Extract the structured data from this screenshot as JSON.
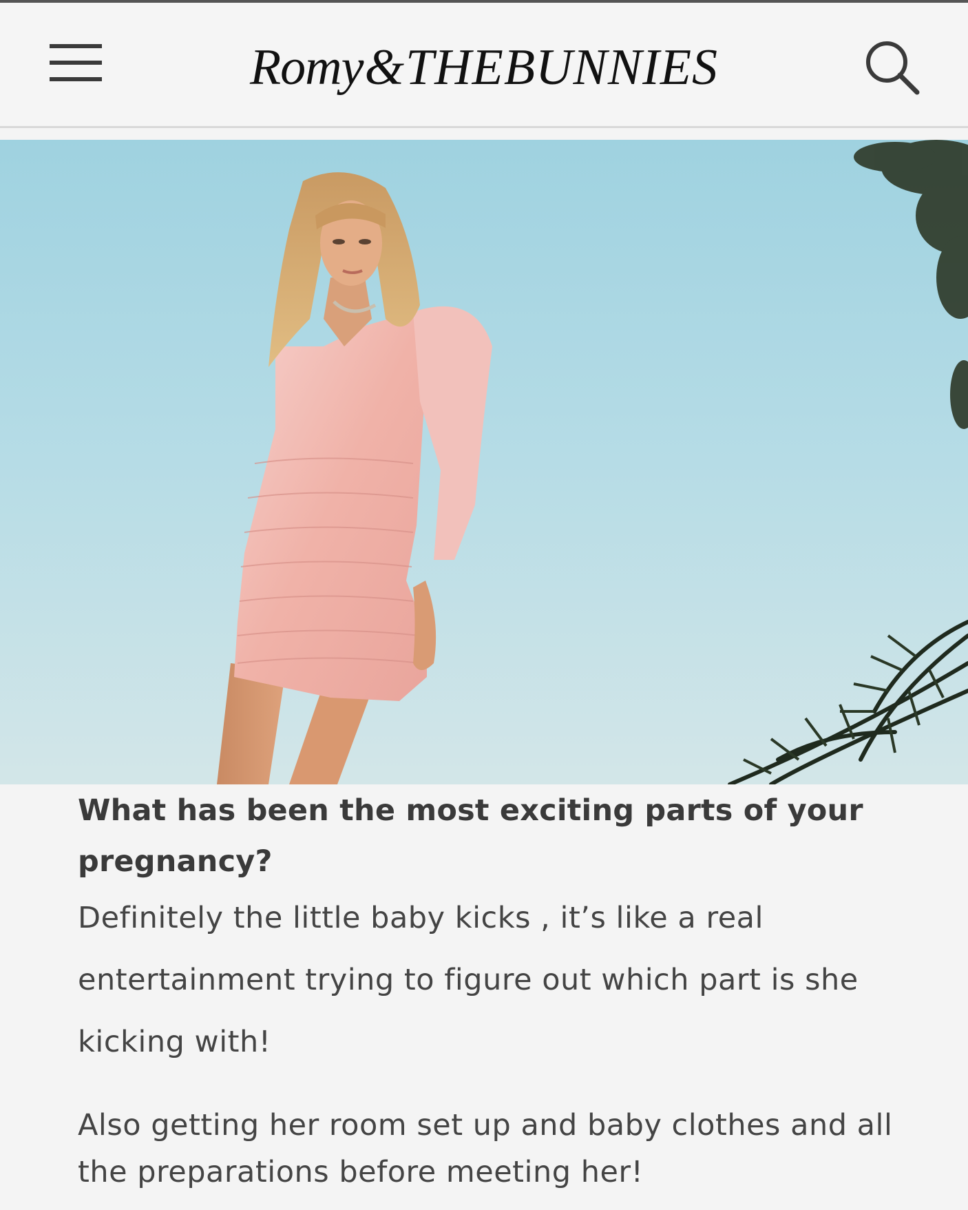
{
  "header": {
    "logo_part1": "Romy",
    "logo_amp": "&",
    "logo_part2": "THEBUNNIES",
    "menu_icon": "hamburger-menu-icon",
    "search_icon": "search-icon"
  },
  "hero": {
    "alt": "Pregnant woman in a pink ruched satin mini dress with puff shoulders, standing against a clear blue sky with palm fronds"
  },
  "article": {
    "question": "What has been the most exciting parts of your pregnancy?",
    "answer_1": "Definitely the little baby kicks , it’s like a real entertainment  trying to figure out which part is she kicking with!",
    "answer_2": "Also getting her room set up and baby clothes and all the preparations before meeting her!"
  },
  "colors": {
    "background": "#f4f4f4",
    "text": "#3a3a3a",
    "sky": "#a9d6e3",
    "dress": "#f0b5ad"
  }
}
